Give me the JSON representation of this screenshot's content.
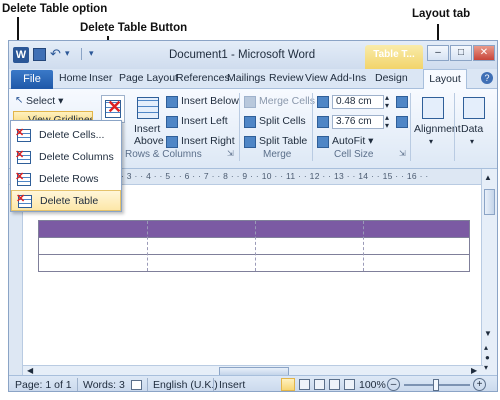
{
  "callouts": {
    "delete_table_option": "Delete Table option",
    "delete_table_button": "Delete Table Button",
    "layout_tab": "Layout tab"
  },
  "window": {
    "title": "Document1 - Microsoft Word",
    "context_header": "Table T...",
    "minimize": "–",
    "maximize": "□",
    "close": "✕",
    "qat_undo": "↶",
    "qat_dropdown": "▾"
  },
  "tabs": {
    "file": "File",
    "home": "Home",
    "insert": "Inser",
    "page_layout": "Page Layout",
    "references": "References",
    "mailings": "Mailings",
    "review": "Review",
    "view": "View",
    "addins": "Add-Ins",
    "design": "Design",
    "layout": "Layout",
    "help": "?"
  },
  "ribbon": {
    "select": "Select ▾",
    "view_gridlines": "View Gridlines",
    "insert_above": "Insert",
    "insert_above_2": "Above",
    "insert_below": "Insert Below",
    "insert_left": "Insert Left",
    "insert_right": "Insert Right",
    "rows_columns_label": "Rows & Columns",
    "merge_cells": "Merge Cells",
    "split_cells": "Split Cells",
    "split_table": "Split Table",
    "merge_label": "Merge",
    "height_value": "0.48 cm",
    "width_value": "3.76 cm",
    "autofit": "AutoFit ▾",
    "cell_size_label": "Cell Size",
    "alignment": "Alignment",
    "data": "Data"
  },
  "delete_menu": {
    "items": [
      {
        "label": "Delete Cells..."
      },
      {
        "label": "Delete Columns"
      },
      {
        "label": "Delete Rows"
      },
      {
        "label": "Delete Table"
      }
    ]
  },
  "ruler": {
    "ticks": "· 3 · · 4 · · 5 · · 6 · · 7 · · 8 · · 9 · · 10 · · 11 · · 12 · · 13 · · 14 · · 15 · · 16 · ·"
  },
  "table": {
    "rows": 3,
    "columns": 4,
    "header_color": "#7b5aa3"
  },
  "statusbar": {
    "page": "Page: 1 of 1",
    "words": "Words: 3",
    "language": "English (U.K.)",
    "mode": "Insert",
    "zoom": "100%",
    "zoom_minus": "–",
    "zoom_plus": "+"
  }
}
